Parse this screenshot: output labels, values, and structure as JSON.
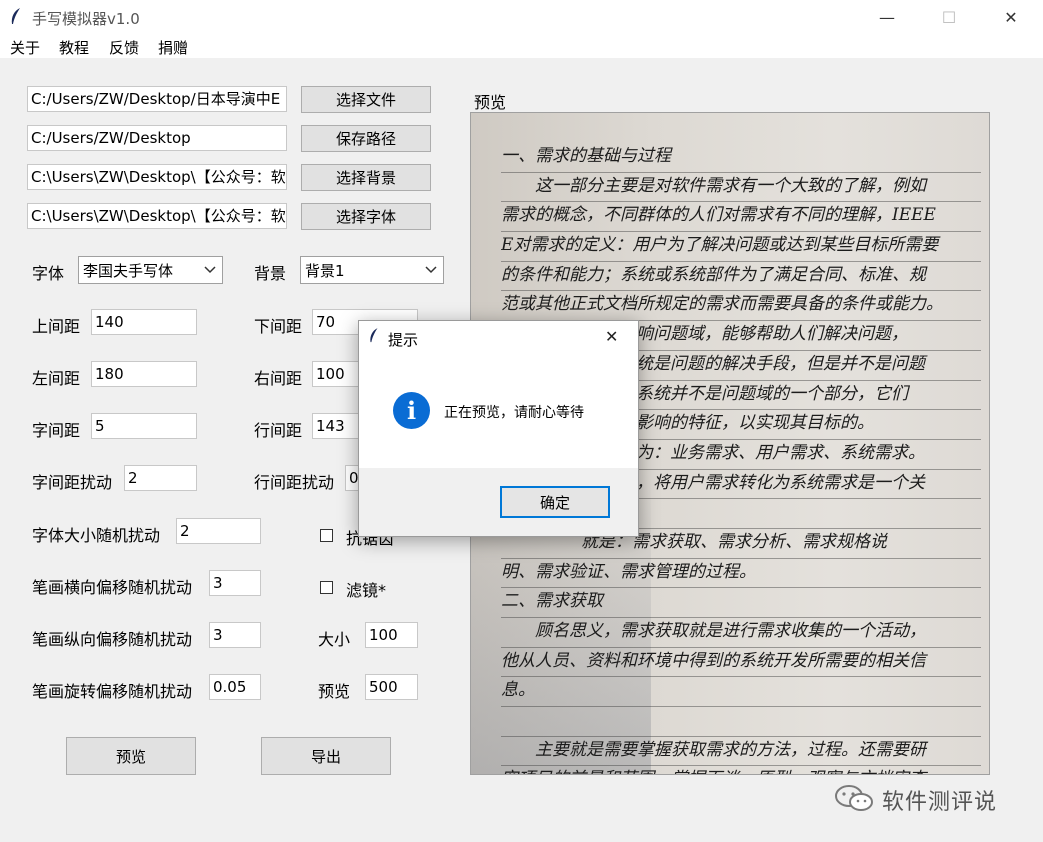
{
  "window": {
    "title": "手写模拟器v1.0",
    "minimize_glyph": "—",
    "maximize_glyph": "☐",
    "close_glyph": "✕"
  },
  "menu": [
    "关于",
    "教程",
    "反馈",
    "捐赠"
  ],
  "paths": [
    {
      "value": "C:/Users/ZW/Desktop/日本导演中E",
      "button": "选择文件"
    },
    {
      "value": "C:/Users/ZW/Desktop",
      "button": "保存路径"
    },
    {
      "value": "C:\\Users\\ZW\\Desktop\\【公众号：软",
      "button": "选择背景"
    },
    {
      "value": "C:\\Users\\ZW\\Desktop\\【公众号：软",
      "button": "选择字体"
    }
  ],
  "font": {
    "label": "字体",
    "selected": "李国夫手写体"
  },
  "background": {
    "label": "背景",
    "selected": "背景1"
  },
  "fields": {
    "top_margin": {
      "label": "上间距",
      "value": "140"
    },
    "bottom_margin": {
      "label": "下间距",
      "value": "70"
    },
    "left_margin": {
      "label": "左间距",
      "value": "180"
    },
    "right_margin": {
      "label": "右间距",
      "value": "100"
    },
    "char_spacing": {
      "label": "字间距",
      "value": "5"
    },
    "line_spacing": {
      "label": "行间距",
      "value": "143"
    },
    "char_spacing_jitter": {
      "label": "字间距扰动",
      "value": "2"
    },
    "line_spacing_jitter": {
      "label": "行间距扰动",
      "value": "0"
    },
    "font_size_jitter": {
      "label": "字体大小随机扰动",
      "value": "2"
    },
    "stroke_x_jitter": {
      "label": "笔画横向偏移随机扰动",
      "value": "3"
    },
    "stroke_y_jitter": {
      "label": "笔画纵向偏移随机扰动",
      "value": "3"
    },
    "stroke_rot_jitter": {
      "label": "笔画旋转偏移随机扰动",
      "value": "0.05"
    },
    "size": {
      "label": "大小",
      "value": "100"
    },
    "preview_px": {
      "label": "预览",
      "value": "500"
    }
  },
  "checks": {
    "antialias": {
      "label": "抗锯齿",
      "checked": false
    },
    "filter": {
      "label": "滤镜*",
      "checked": false
    }
  },
  "buttons": {
    "preview": "预览",
    "export": "导出"
  },
  "preview_label": "预览",
  "handwriting_lines": [
    "一、需求的基础与过程",
    "这一部分主要是对软件需求有一个大致的了解，例如",
    "需求的概念，不同群体的人们对需求有不同的理解，IEEE",
    "E对需求的定义：用户为了解决问题或达到某些目标所需要",
    "的条件和能力；系统或系统部件为了满足合同、标准、规",
    "范或其他正式文档所规定的需求而需要具备的条件或能力。",
    "影响问题域，能够帮助人们解决问题，",
    "系统是问题的解决手段，但是并不是问题",
    "解系统并不是问题域的一个部分，它们",
    "至影响的特征，以实现其目标的。",
    "分为：业务需求、用户需求、系统需求。",
    "引，将用户需求转化为系统需求是一个关",
    "",
    "就是：需求获取、需求分析、需求规格说",
    "明、需求验证、需求管理的过程。",
    "二、需求获取",
    "顾名思义，需求获取就是进行需求收集的一个活动，",
    "他从人员、资料和环境中得到的系统开发所需要的相关信",
    "息。",
    "",
    "主要就是需要掌握获取需求的方法，过程。还需要研",
    "究项目的前景和范围，掌握面谈、原型、观察与文档审查"
  ],
  "dialog": {
    "title": "提示",
    "message": "正在预览，请耐心等待",
    "ok": "确定",
    "close_glyph": "✕",
    "info_glyph": "i"
  },
  "watermark": "软件测评说",
  "colors": {
    "accent": "#0078d7",
    "info": "#0a6cd4"
  }
}
